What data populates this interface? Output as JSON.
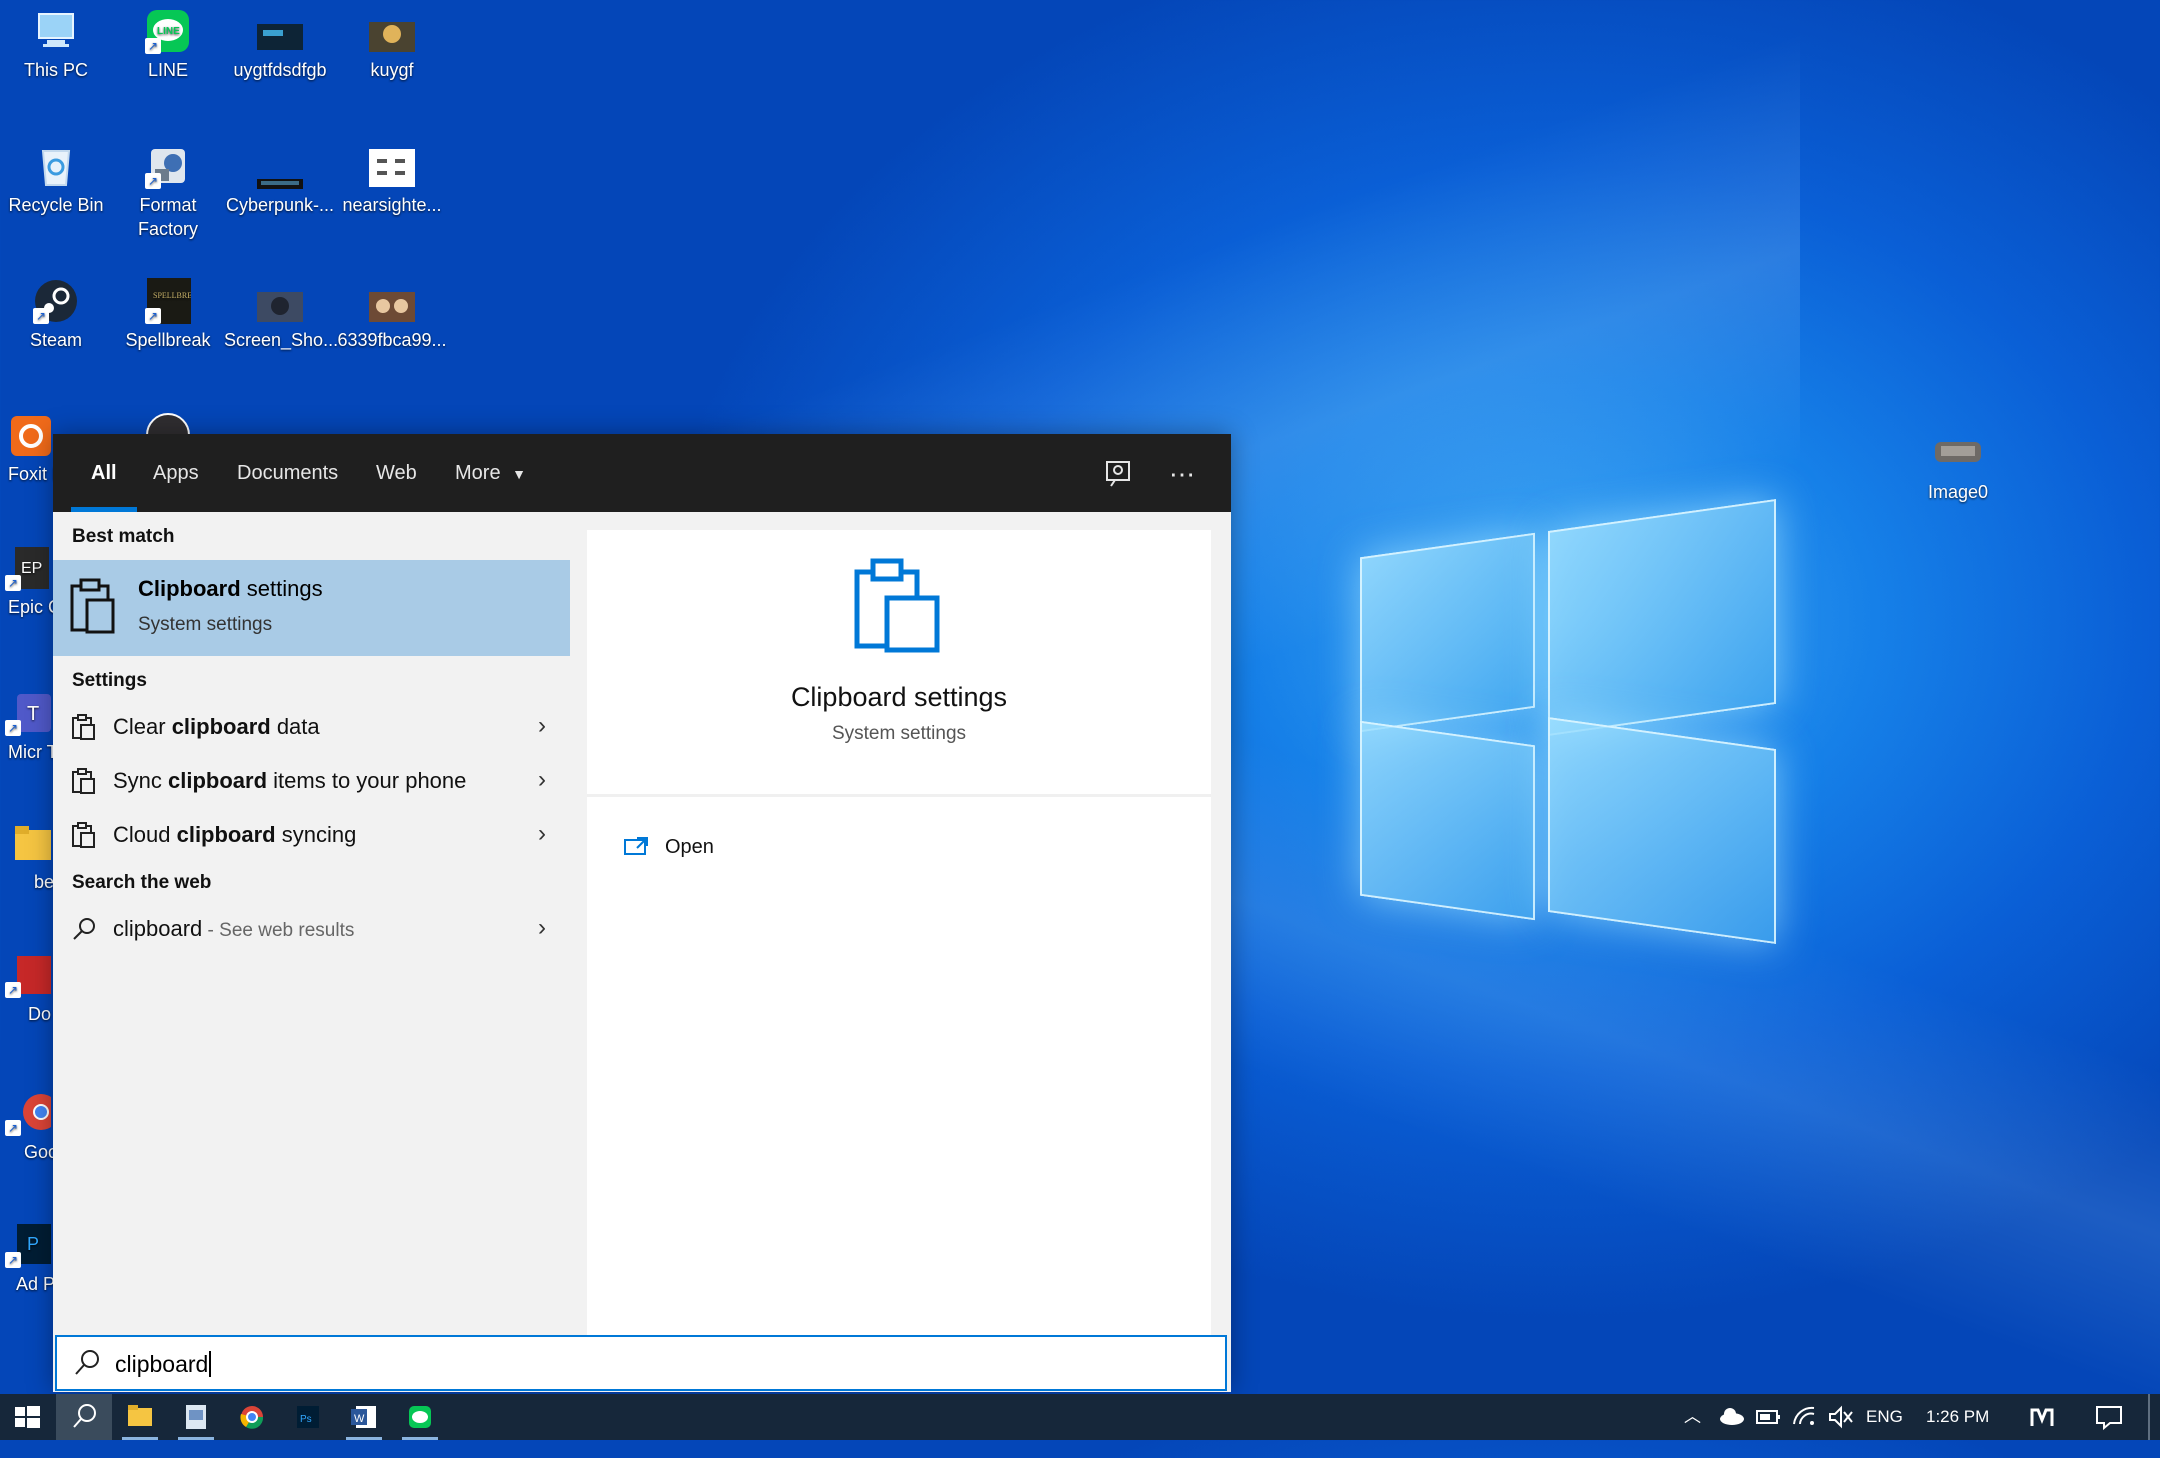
{
  "desktop": {
    "icons_col1": [
      {
        "label": "This PC",
        "icon": "this-pc-icon"
      },
      {
        "label": "Recycle Bin",
        "icon": "recycle-bin-icon"
      },
      {
        "label": "Steam",
        "icon": "steam-icon"
      },
      {
        "label": "Foxit I",
        "icon": "foxit-icon"
      },
      {
        "label": "Epic G Laun",
        "icon": "epic-games-icon"
      },
      {
        "label": "Micr Tea",
        "icon": "microsoft-teams-icon"
      },
      {
        "label": "be",
        "icon": "folder-icon"
      },
      {
        "label": "Do",
        "icon": "app-icon"
      },
      {
        "label": "Goo Chro",
        "icon": "chrome-icon"
      },
      {
        "label": "Ad Phot",
        "icon": "photoshop-icon"
      }
    ],
    "icons_col2": [
      {
        "label": "LINE",
        "icon": "line-icon"
      },
      {
        "label": "Format Factory",
        "icon": "format-factory-icon"
      },
      {
        "label": "Spellbreak",
        "icon": "spellbreak-icon"
      }
    ],
    "icons_col3": [
      {
        "label": "uygtfdsdfgb",
        "icon": "image-file-icon"
      },
      {
        "label": "Cyberpunk-...",
        "icon": "image-file-icon"
      },
      {
        "label": "Screen_Sho...",
        "icon": "image-file-icon"
      }
    ],
    "icons_col4": [
      {
        "label": "kuygf",
        "icon": "image-file-icon"
      },
      {
        "label": "nearsighte...",
        "icon": "image-file-icon"
      },
      {
        "label": "6339fbca99...",
        "icon": "image-file-icon"
      }
    ],
    "icon_right": {
      "label": "Image0",
      "icon": "image-file-icon"
    }
  },
  "search": {
    "tabs": [
      "All",
      "Apps",
      "Documents",
      "Web",
      "More"
    ],
    "active_tab": "All",
    "best_match_heading": "Best match",
    "best_match": {
      "title": "Clipboard settings",
      "title_bold": "Clipboard",
      "title_rest": " settings",
      "subtitle": "System settings"
    },
    "settings_heading": "Settings",
    "settings_items": [
      {
        "pre": "Clear ",
        "bold": "clipboard",
        "post": " data"
      },
      {
        "pre": "Sync ",
        "bold": "clipboard",
        "post": " items to your phone"
      },
      {
        "pre": "Cloud ",
        "bold": "clipboard",
        "post": " syncing"
      }
    ],
    "web_heading": "Search the web",
    "web_item": {
      "query": "clipboard",
      "hint": " - See web results"
    },
    "detail": {
      "title": "Clipboard settings",
      "subtitle": "System settings",
      "open_label": "Open"
    },
    "query": "clipboard"
  },
  "taskbar": {
    "apps": [
      "start-icon",
      "search-icon",
      "file-explorer-icon",
      "image-viewer-icon",
      "chrome-icon",
      "photoshop-icon",
      "word-icon",
      "line-icon"
    ],
    "language": "ENG",
    "time": "1:26 PM"
  },
  "colors": {
    "accent": "#0078d7",
    "selected": "#a9cbe6",
    "tabbar": "#1f1f1f",
    "taskbar": "#16273a"
  }
}
